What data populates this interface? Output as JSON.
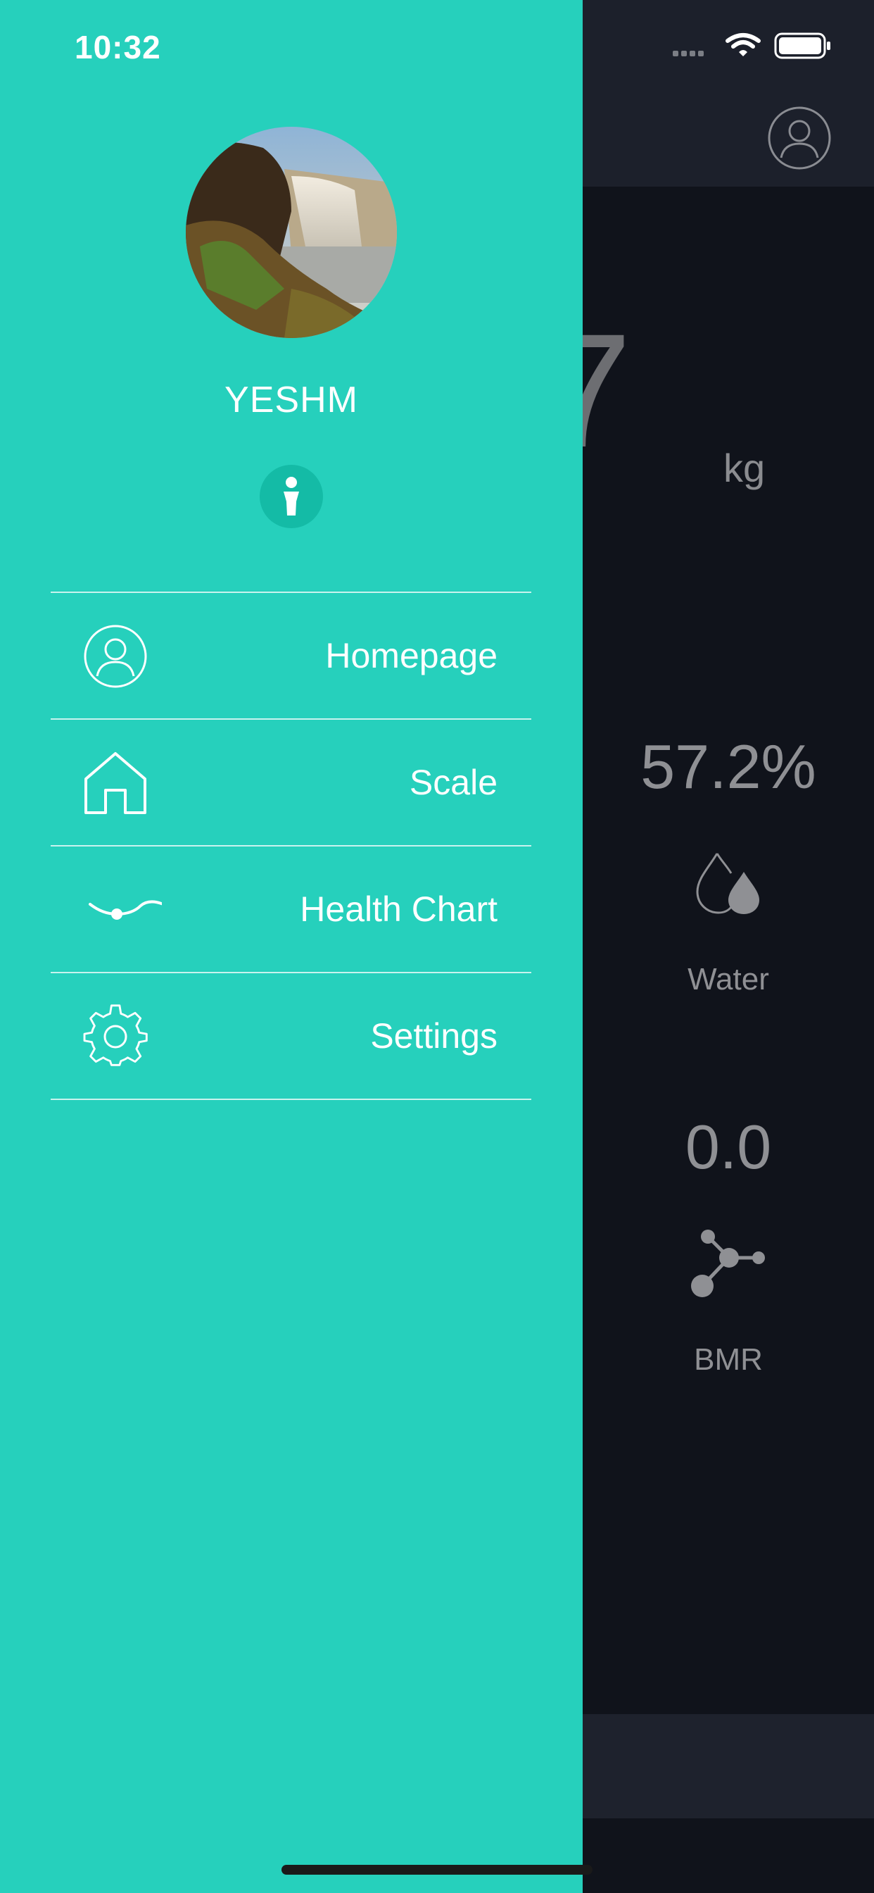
{
  "status_bar": {
    "time": "10:32"
  },
  "profile": {
    "username": "YESHM"
  },
  "menu": {
    "items": [
      {
        "label": "Homepage",
        "icon": "person-circle-icon"
      },
      {
        "label": "Scale",
        "icon": "house-icon"
      },
      {
        "label": "Health Chart",
        "icon": "wave-chart-icon"
      },
      {
        "label": "Settings",
        "icon": "gear-icon"
      }
    ]
  },
  "background_screen": {
    "weight_partial_digit": "7",
    "weight_unit": "kg",
    "metrics": [
      {
        "value": "57.2%",
        "label": "Water",
        "icon": "water-drops-icon"
      },
      {
        "value": "0.0",
        "label": "BMR",
        "icon": "molecule-icon"
      }
    ]
  },
  "colors": {
    "drawer_bg": "#26d0bc",
    "info_badge": "#14bba6",
    "app_bg": "#10131b",
    "app_header": "#1c202b"
  }
}
